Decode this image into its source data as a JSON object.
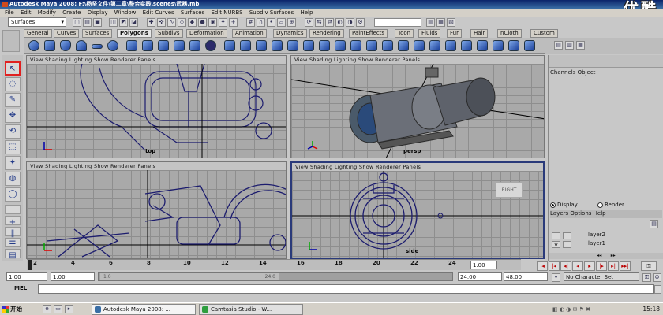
{
  "window": {
    "title": "Autodesk Maya 2008: F:\\杨坚文件\\第二章\\整合实践\\scenes\\武器.mb"
  },
  "watermark": "优酷",
  "menubar": [
    "File",
    "Edit",
    "Modify",
    "Create",
    "Display",
    "Window",
    "Edit Curves",
    "Surfaces",
    "Edit NURBS",
    "Subdiv Surfaces",
    "Help"
  ],
  "statusline": {
    "menu_set": "Surfaces"
  },
  "shelf_tabs": [
    {
      "label": "General",
      "active": false
    },
    {
      "label": "Curves",
      "active": false
    },
    {
      "label": "Surfaces",
      "active": false
    },
    {
      "label": "Polygons",
      "active": true
    },
    {
      "label": "Subdivs",
      "active": false
    },
    {
      "label": "Deformation",
      "active": false
    },
    {
      "label": "Animation",
      "active": false
    },
    {
      "label": "Dynamics",
      "active": false
    },
    {
      "label": "Rendering",
      "active": false
    },
    {
      "label": "PaintEffects",
      "active": false
    },
    {
      "label": "Toon",
      "active": false
    },
    {
      "label": "Fluids",
      "active": false
    },
    {
      "label": "Fur",
      "active": false
    },
    {
      "label": "Hair",
      "active": false
    },
    {
      "label": "nCloth",
      "active": false
    },
    {
      "label": "Custom",
      "active": false
    }
  ],
  "viewport_menu": "View  Shading  Lighting  Show  Renderer  Panels",
  "viewports": [
    {
      "label": "top",
      "active": false
    },
    {
      "label": "persp",
      "active": false
    },
    {
      "label": "",
      "active": false
    },
    {
      "label": "side",
      "active": true
    }
  ],
  "view_cube": "RIGHT",
  "channel_box": {
    "menu": "Channels  Object"
  },
  "layer_editor": {
    "display_label": "Display",
    "render_label": "Render",
    "mode": "Display",
    "menu": "Layers  Options  Help",
    "layers": [
      {
        "name": "layer2",
        "visible": false
      },
      {
        "name": "layer1",
        "visible": true
      }
    ]
  },
  "timeline": {
    "ticks": [
      "2",
      "4",
      "6",
      "8",
      "10",
      "12",
      "14",
      "16",
      "18",
      "20",
      "22",
      "24"
    ],
    "current_frame": "1.00"
  },
  "range": {
    "start": "1.00",
    "playback_start": "1.00",
    "left_slider": "1.0",
    "right_slider": "24.0",
    "playback_end": "24.00",
    "end": "48.00",
    "character_set": "No Character Set"
  },
  "command_line": {
    "label": "MEL"
  },
  "taskbar": {
    "start": "开始",
    "tasks": [
      {
        "label": "Autodesk Maya 2008: ...",
        "color": "#3a6ea5"
      },
      {
        "label": "Camtasia Studio - W...",
        "color": "#2e9e3e"
      }
    ],
    "clock": "15:18"
  }
}
